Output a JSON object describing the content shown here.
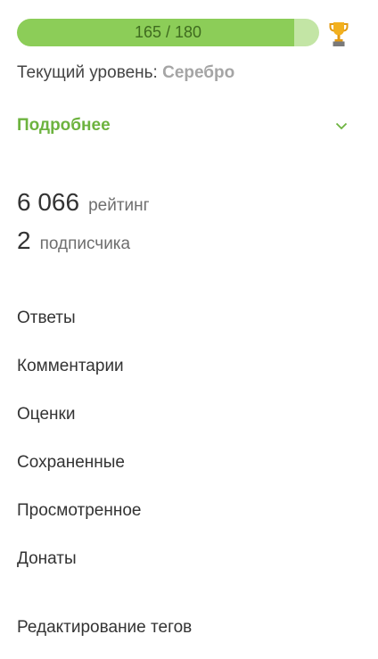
{
  "progress": {
    "text": "165 / 180",
    "current": 165,
    "max": 180,
    "fill_color": "#8ccd58",
    "track_color": "#c3e5a5",
    "icon": "trophy-icon"
  },
  "level": {
    "label": "Текущий уровень: ",
    "value": "Серебро"
  },
  "details": {
    "label": "Подробнее",
    "icon": "chevron-down-icon",
    "accent_color": "#6db33f"
  },
  "stats": {
    "rating": {
      "value": "6 066",
      "label": "рейтинг"
    },
    "subscribers": {
      "value": "2",
      "label": "подписчика"
    }
  },
  "menu": [
    "Ответы",
    "Комментарии",
    "Оценки",
    "Сохраненные",
    "Просмотренное",
    "Донаты",
    "Редактирование тегов"
  ]
}
